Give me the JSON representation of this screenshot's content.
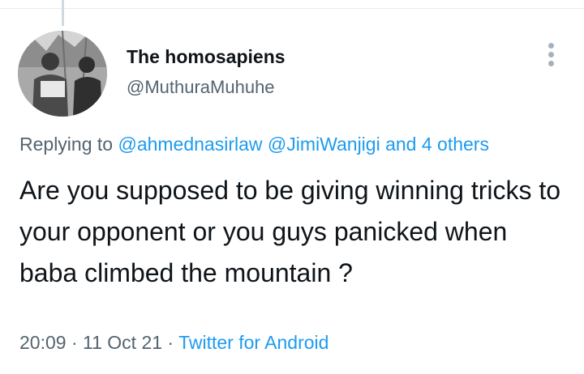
{
  "author": {
    "display_name": "The homosapiens",
    "handle": "@MuthuraMuhuhe"
  },
  "icons": {
    "more": "more-vertical-icon",
    "avatar": "profile-photo"
  },
  "reply": {
    "prefix": "Replying to",
    "mention_1": "@ahmednasirlaw",
    "mention_2": "@JimiWanjigi",
    "others": "and 4 others"
  },
  "tweet": {
    "text": "Are you supposed to be giving winning tricks to your opponent or you guys panicked when baba climbed the mountain ?"
  },
  "meta": {
    "time": "20:09",
    "sep1": " · ",
    "date": "11 Oct 21",
    "sep2": " · ",
    "source": "Twitter for Android"
  },
  "colors": {
    "accent": "#1d9bf0",
    "secondary_text": "#536471",
    "primary_text": "#0f1419"
  }
}
